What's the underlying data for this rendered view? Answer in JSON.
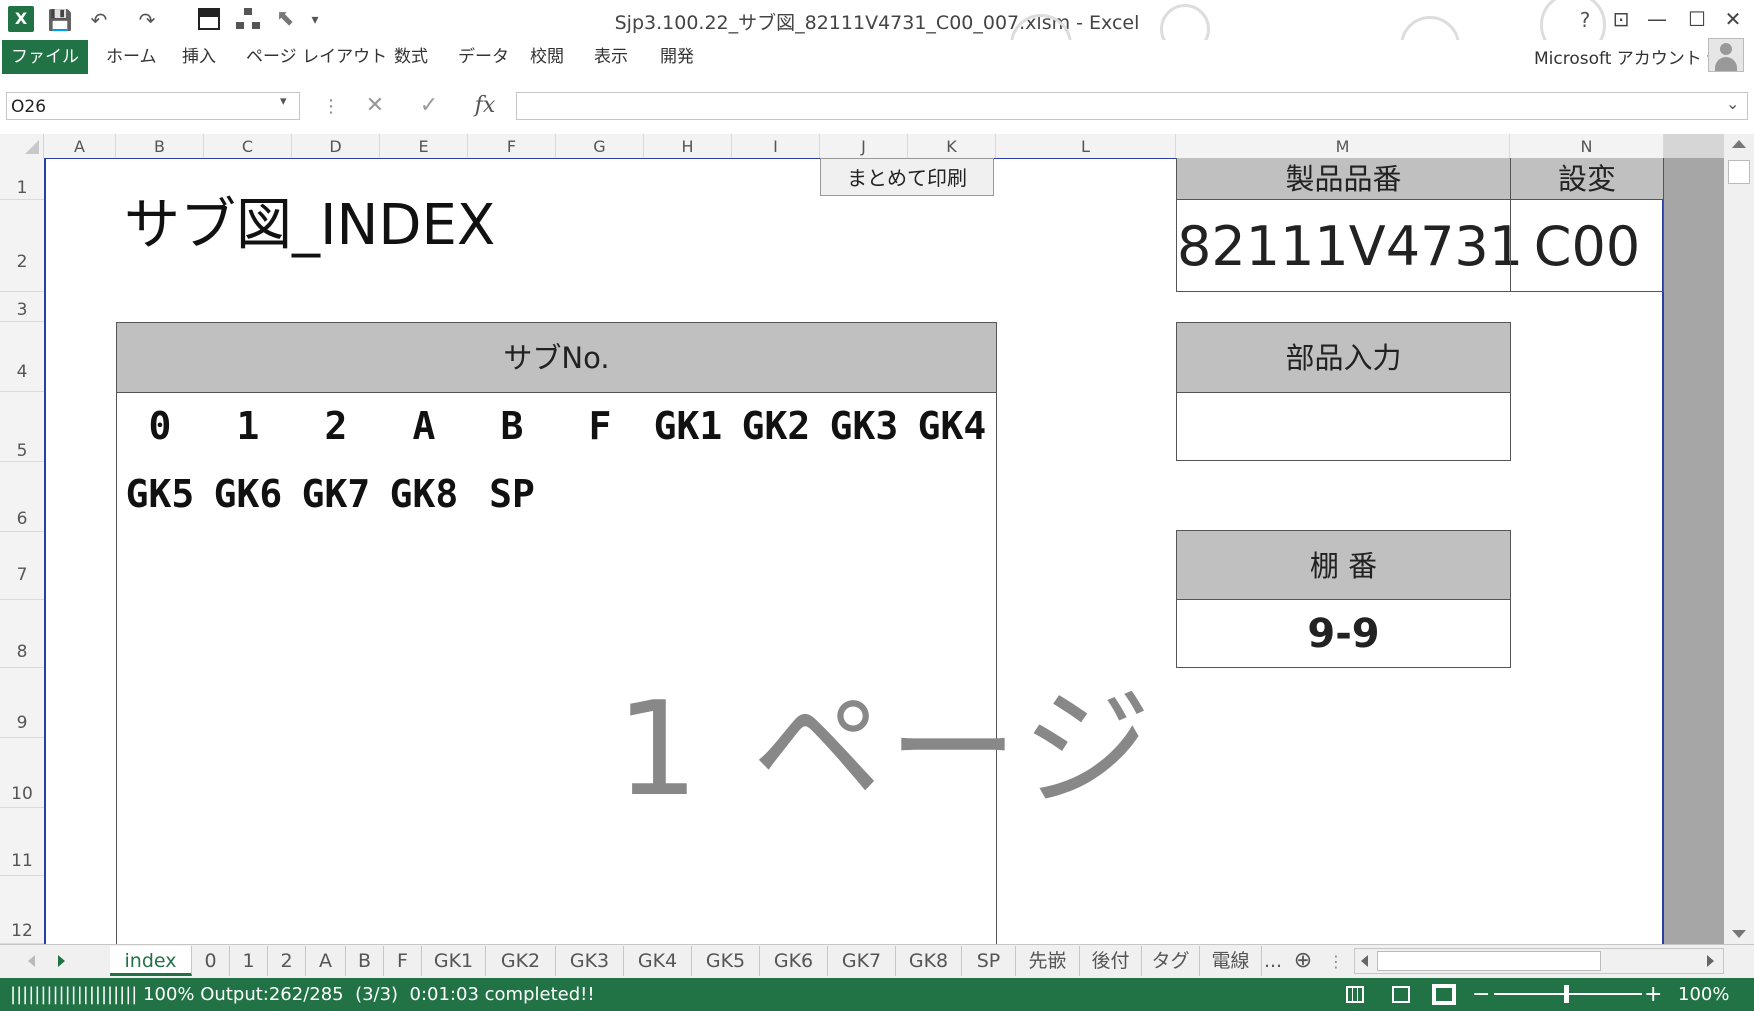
{
  "window": {
    "title": "Sjp3.100.22_サブ図_82111V4731_C00_007.xlsm - Excel",
    "help": "?",
    "controls": {
      "ribbon_display": "⊡",
      "minimize": "—",
      "maximize": "☐",
      "close": "✕"
    }
  },
  "quick_access": {
    "save": "💾",
    "undo": "↶",
    "redo": "↷",
    "customize": "▾"
  },
  "ribbon": {
    "file_tab": "ファイル",
    "tabs": [
      "ホーム",
      "挿入",
      "ページ レイアウト",
      "数式",
      "データ",
      "校閲",
      "表示",
      "開発"
    ],
    "account": "Microsoft アカウント ▾"
  },
  "formula_bar": {
    "name_box": "O26",
    "name_box_arrow": "▾",
    "cancel": "✕",
    "enter": "✓",
    "fx": "fx",
    "value": "",
    "expand": "⌄"
  },
  "columns": [
    "A",
    "B",
    "C",
    "D",
    "E",
    "F",
    "G",
    "H",
    "I",
    "J",
    "K",
    "L",
    "M",
    "N"
  ],
  "rows": [
    "1",
    "2",
    "3",
    "4",
    "5",
    "6",
    "7",
    "8",
    "9",
    "10",
    "11",
    "12"
  ],
  "sheet": {
    "title": "サブ図_INDEX",
    "print_button": "まとめて印刷",
    "product_number_label": "製品品番",
    "product_number": "82111V4731",
    "revision_label": "設変",
    "revision": "C00",
    "sub_no_label": "サブNo.",
    "sub_row1": [
      "0",
      "1",
      "2",
      "A",
      "B",
      "F",
      "GK1",
      "GK2",
      "GK3",
      "GK4"
    ],
    "sub_row2": [
      "GK5",
      "GK6",
      "GK7",
      "GK8",
      "SP"
    ],
    "parts_input_label": "部品入力",
    "parts_input_value": "",
    "shelf_label": "棚 番",
    "shelf_value": "9-9",
    "page_watermark": "1 ページ"
  },
  "sheet_tabs": {
    "items": [
      "index",
      "0",
      "1",
      "2",
      "A",
      "B",
      "F",
      "GK1",
      "GK2",
      "GK3",
      "GK4",
      "GK5",
      "GK6",
      "GK7",
      "GK8",
      "SP",
      "先嵌",
      "後付",
      "タグ",
      "電線"
    ],
    "active": "index",
    "more": "...",
    "add": "⊕"
  },
  "status_bar": {
    "message": "||||||||||||||||||||| 100% Output:262/285  (3/3)  0:01:03 completed!!",
    "zoom": "100%",
    "zoom_minus": "−",
    "zoom_plus": "+"
  }
}
